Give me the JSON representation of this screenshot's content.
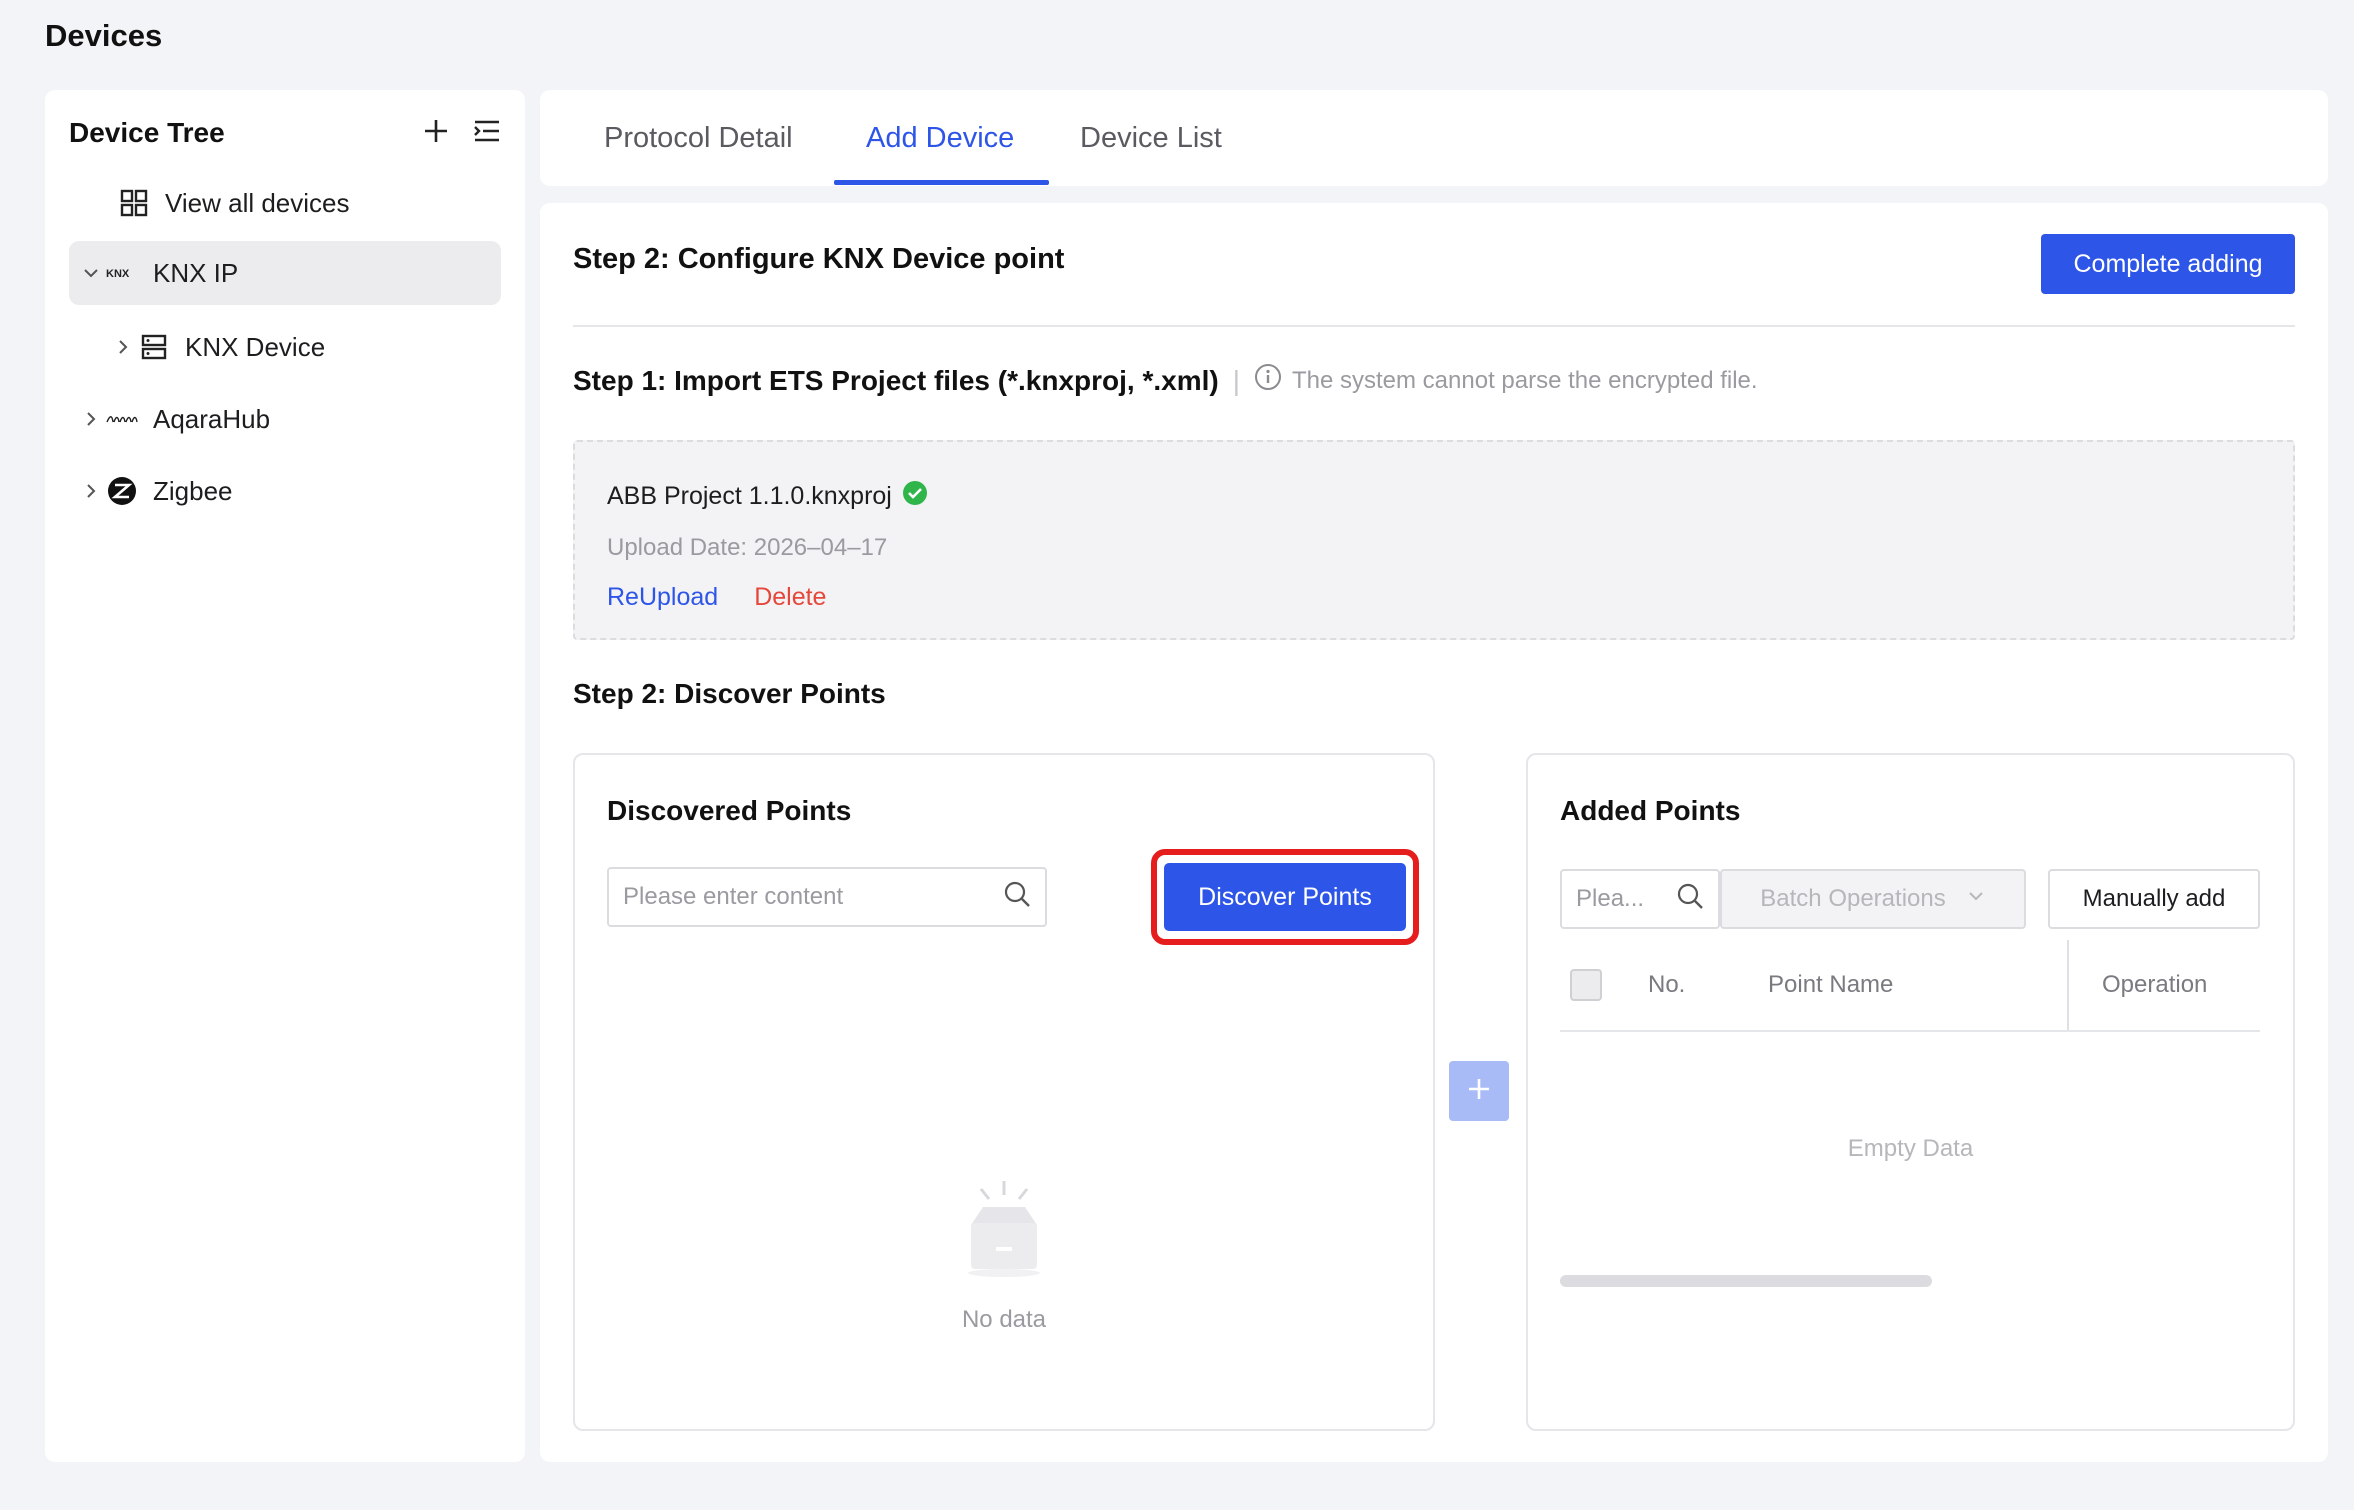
{
  "page": {
    "title": "Devices"
  },
  "sidebar": {
    "title": "Device Tree",
    "items": [
      {
        "label": "View all devices",
        "icon": "grid-icon"
      },
      {
        "label": "KNX IP",
        "icon": "knx-logo-icon",
        "selected": true,
        "expanded": true
      },
      {
        "label": "KNX Device",
        "icon": "server-icon"
      },
      {
        "label": "AqaraHub",
        "icon": "aqara-logo-icon"
      },
      {
        "label": "Zigbee",
        "icon": "zigbee-logo-icon"
      }
    ]
  },
  "tabs": [
    {
      "label": "Protocol Detail"
    },
    {
      "label": "Add Device",
      "active": true
    },
    {
      "label": "Device List"
    }
  ],
  "main": {
    "header": "Step 2: Configure KNX Device point",
    "complete_button": "Complete adding",
    "step1": {
      "title": "Step 1:  Import ETS Project files (*.knxproj, *.xml)",
      "separator": "|",
      "note": "The system cannot parse the encrypted file."
    },
    "upload": {
      "file_name": "ABB Project 1.1.0.knxproj",
      "upload_date": "Upload Date: 2026–04–17",
      "reupload": "ReUpload",
      "delete": "Delete"
    },
    "step2": {
      "title": "Step 2:  Discover Points"
    },
    "discovered": {
      "title": "Discovered Points",
      "search_placeholder": "Please enter content",
      "discover_button": "Discover Points",
      "empty_text": "No data"
    },
    "added": {
      "title": "Added Points",
      "search_placeholder": "Plea...",
      "batch_button": "Batch Operations",
      "manual_button": "Manually add",
      "columns": [
        "No.",
        "Point Name",
        "Operation"
      ],
      "empty_text": "Empty Data"
    }
  },
  "colors": {
    "primary": "#2d55e8",
    "danger": "#e5483a",
    "highlight": "#e51d1d",
    "success": "#2fb54a"
  }
}
